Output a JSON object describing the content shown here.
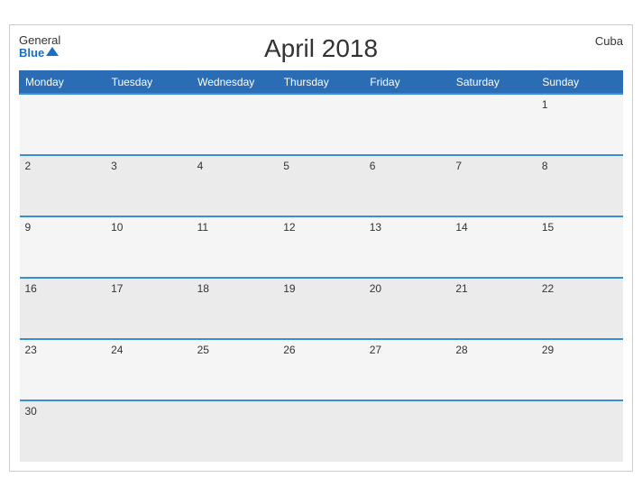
{
  "header": {
    "logo_general": "General",
    "logo_blue": "Blue",
    "title": "April 2018",
    "country": "Cuba"
  },
  "weekdays": [
    "Monday",
    "Tuesday",
    "Wednesday",
    "Thursday",
    "Friday",
    "Saturday",
    "Sunday"
  ],
  "weeks": [
    [
      "",
      "",
      "",
      "",
      "",
      "",
      "1"
    ],
    [
      "2",
      "3",
      "4",
      "5",
      "6",
      "7",
      "8"
    ],
    [
      "9",
      "10",
      "11",
      "12",
      "13",
      "14",
      "15"
    ],
    [
      "16",
      "17",
      "18",
      "19",
      "20",
      "21",
      "22"
    ],
    [
      "23",
      "24",
      "25",
      "26",
      "27",
      "28",
      "29"
    ],
    [
      "30",
      "",
      "",
      "",
      "",
      "",
      ""
    ]
  ]
}
